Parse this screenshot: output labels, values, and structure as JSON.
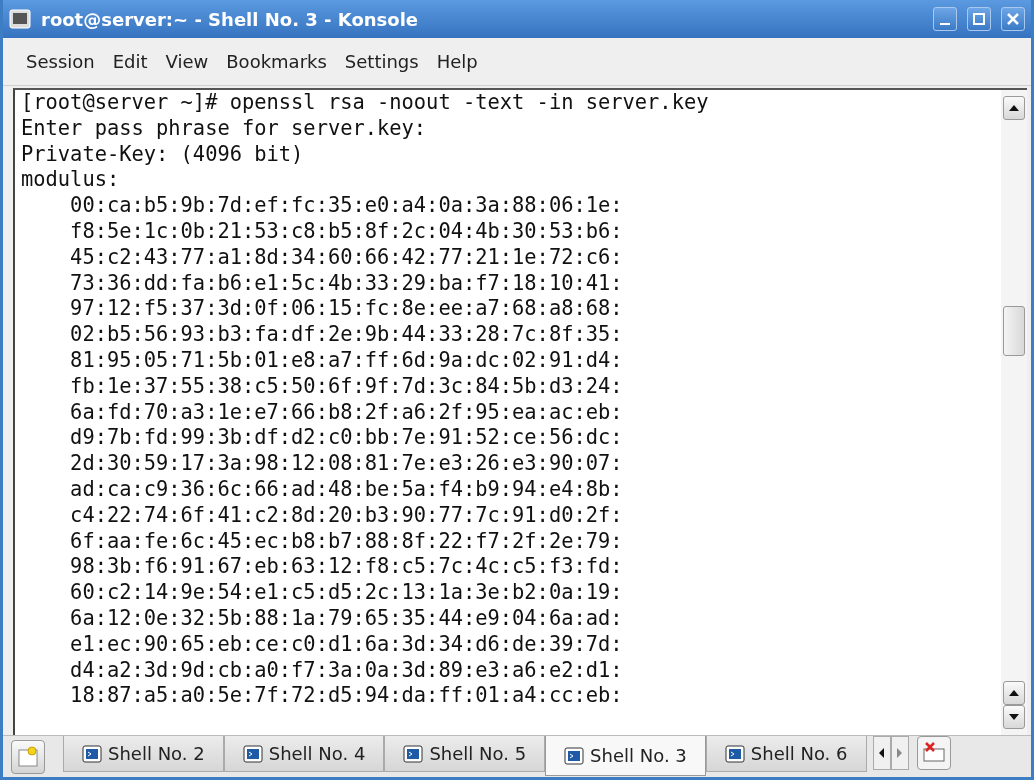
{
  "window": {
    "title": "root@server:~ - Shell No. 3 - Konsole"
  },
  "menu": [
    "Session",
    "Edit",
    "View",
    "Bookmarks",
    "Settings",
    "Help"
  ],
  "terminal": {
    "lines": [
      "[root@server ~]# openssl rsa -noout -text -in server.key",
      "Enter pass phrase for server.key:",
      "Private-Key: (4096 bit)",
      "modulus:",
      "    00:ca:b5:9b:7d:ef:fc:35:e0:a4:0a:3a:88:06:1e:",
      "    f8:5e:1c:0b:21:53:c8:b5:8f:2c:04:4b:30:53:b6:",
      "    45:c2:43:77:a1:8d:34:60:66:42:77:21:1e:72:c6:",
      "    73:36:dd:fa:b6:e1:5c:4b:33:29:ba:f7:18:10:41:",
      "    97:12:f5:37:3d:0f:06:15:fc:8e:ee:a7:68:a8:68:",
      "    02:b5:56:93:b3:fa:df:2e:9b:44:33:28:7c:8f:35:",
      "    81:95:05:71:5b:01:e8:a7:ff:6d:9a:dc:02:91:d4:",
      "    fb:1e:37:55:38:c5:50:6f:9f:7d:3c:84:5b:d3:24:",
      "    6a:fd:70:a3:1e:e7:66:b8:2f:a6:2f:95:ea:ac:eb:",
      "    d9:7b:fd:99:3b:df:d2:c0:bb:7e:91:52:ce:56:dc:",
      "    2d:30:59:17:3a:98:12:08:81:7e:e3:26:e3:90:07:",
      "    ad:ca:c9:36:6c:66:ad:48:be:5a:f4:b9:94:e4:8b:",
      "    c4:22:74:6f:41:c2:8d:20:b3:90:77:7c:91:d0:2f:",
      "    6f:aa:fe:6c:45:ec:b8:b7:88:8f:22:f7:2f:2e:79:",
      "    98:3b:f6:91:67:eb:63:12:f8:c5:7c:4c:c5:f3:fd:",
      "    60:c2:14:9e:54:e1:c5:d5:2c:13:1a:3e:b2:0a:19:",
      "    6a:12:0e:32:5b:88:1a:79:65:35:44:e9:04:6a:ad:",
      "    e1:ec:90:65:eb:ce:c0:d1:6a:3d:34:d6:de:39:7d:",
      "    d4:a2:3d:9d:cb:a0:f7:3a:0a:3d:89:e3:a6:e2:d1:",
      "    18:87:a5:a0:5e:7f:72:d5:94:da:ff:01:a4:cc:eb:"
    ]
  },
  "tabs": [
    {
      "label": "Shell No. 2",
      "selected": false
    },
    {
      "label": "Shell No. 4",
      "selected": false
    },
    {
      "label": "Shell No. 5",
      "selected": false
    },
    {
      "label": "Shell No. 3",
      "selected": true
    },
    {
      "label": "Shell No. 6",
      "selected": false
    }
  ]
}
